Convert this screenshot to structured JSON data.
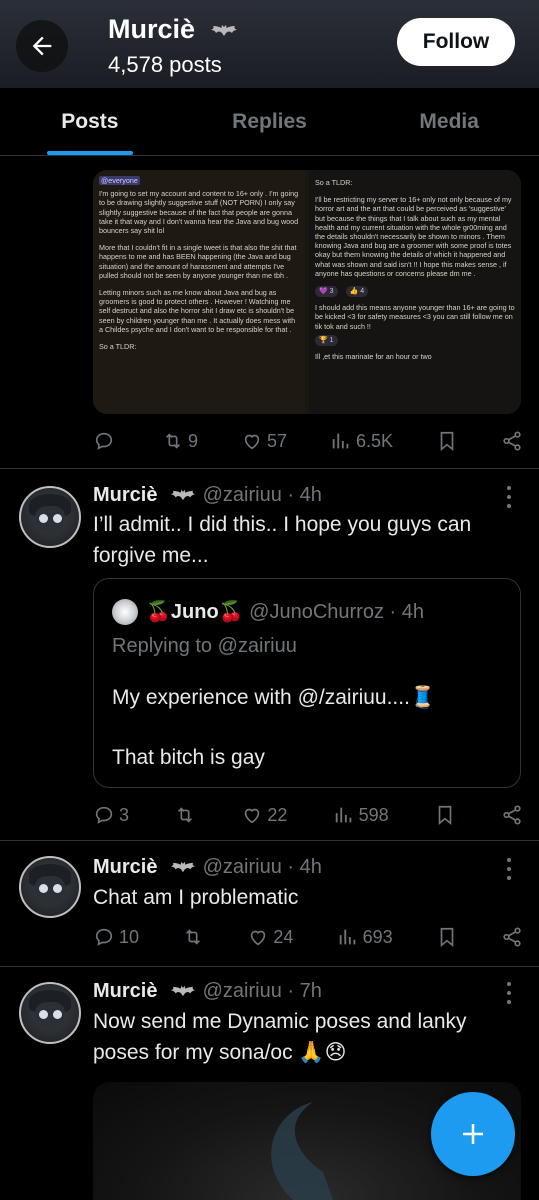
{
  "header": {
    "name": "Murciè",
    "posts_count": "4,578 posts",
    "follow_label": "Follow"
  },
  "tabs": [
    {
      "label": "Posts",
      "active": true
    },
    {
      "label": "Replies",
      "active": false
    },
    {
      "label": "Media",
      "active": false
    }
  ],
  "post1": {
    "image_left_text": [
      "@everyone",
      "I'm going to set my account and content to 16+ only . I'm going to be drawing slightly suggestive stuff (NOT PORN) I only say slightly suggestive because of the fact that people are gonna take it that way and I don't wanna hear the Java and bug wood bouncers say shit lol",
      "More that I couldn't fit in a single tweet is that also the shit that happens to me and has BEEN happening (the Java and bug situation) and the amount of harassment and attempts I've pulled should not be seen by anyone younger than me tbh .",
      "Letting minors such as me know about Java and bug as groomers is good to protect others . However ! Watching me self destruct and also the horror shit I draw etc is shouldn't be seen by children younger than me . It actually does mess with a Childes psyche and I don't want to be responsible for that .",
      "So a TLDR:"
    ],
    "image_right_text": [
      "So a TLDR:",
      "I'll be restricting my server to 16+ only not only because of my horror art and the art that could be perceived as 'suggestive' but because the things that I talk about such as my mental health and my current situation with the whole gr00ming and the details shouldn't necessarily be shown to minors . Them knowing Java and bug are a groomer with some proof is totes okay but them knowing the details of which it happened and what was shown and said isn't !! I hope this makes sense , if anyone has questions or concerns please dm me .",
      "I should add this means anyone younger than 16+ are going to be kicked <3 for safety measures <3 you can still follow me on tik tok and such !!",
      "Ill ,et this marinate for an hour or two"
    ],
    "reactions": [
      "3",
      "4",
      "1"
    ],
    "actions": {
      "replies": "",
      "reposts": "9",
      "likes": "57",
      "views": "6.5K"
    }
  },
  "post2": {
    "name": "Murciè",
    "handle": "@zairiuu · 4h",
    "text": "I’ll admit.. I did this.. I hope you guys can forgive me...",
    "quote": {
      "name": "🍒Juno🍒",
      "handle": "@JunoChurroz · 4h",
      "replying_prefix": "Replying to ",
      "replying_to": "@zairiuu",
      "text": "My experience with @/zairiuu....🧵\n\nThat bitch is gay"
    },
    "actions": {
      "replies": "3",
      "reposts": "",
      "likes": "22",
      "views": "598"
    }
  },
  "post3": {
    "name": "Murciè",
    "handle": "@zairiuu · 4h",
    "text": "Chat am I problematic",
    "actions": {
      "replies": "10",
      "reposts": "",
      "likes": "24",
      "views": "693"
    }
  },
  "post4": {
    "name": "Murciè",
    "handle": "@zairiuu · 7h",
    "text": "Now send me Dynamic poses and lanky poses for my sona/oc 🙏😞"
  },
  "colors": {
    "accent": "#1d9bf0",
    "muted": "#71767b",
    "text": "#e7e9ea",
    "divider": "#2f3336"
  },
  "icons": [
    "back-arrow-icon",
    "bat-icon",
    "reply-icon",
    "repost-icon",
    "like-icon",
    "views-icon",
    "bookmark-icon",
    "share-icon",
    "more-icon",
    "compose-plus-icon"
  ]
}
